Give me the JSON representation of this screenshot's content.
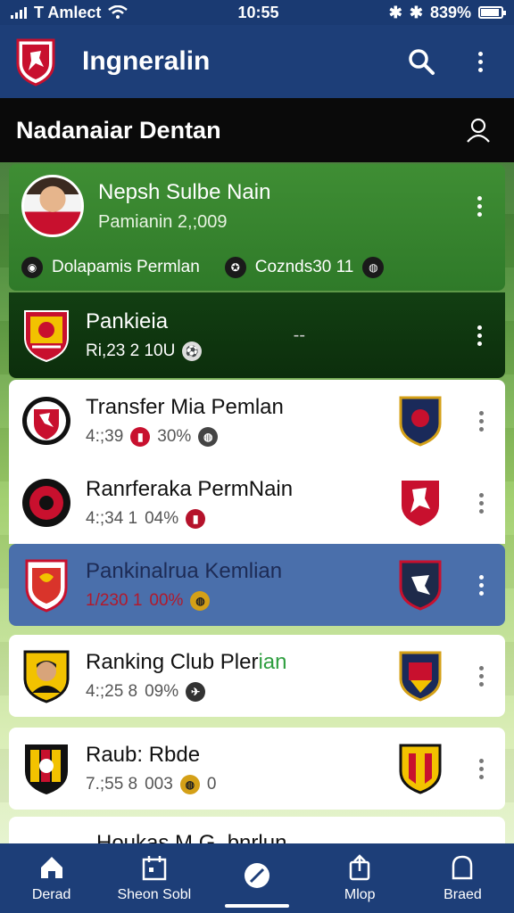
{
  "status_bar": {
    "carrier": "T Amlect",
    "time": "10:55",
    "battery": "839%"
  },
  "app_bar": {
    "title": "Ingneralin"
  },
  "section": {
    "title": "Nadanaiar Dentan"
  },
  "featured": {
    "name": "Nepsh Sulbe Nain",
    "subtitle": "Pamianin 2,;009",
    "left_stat": "Dolapamis Permlan",
    "right_stat": "Coznds30  11"
  },
  "dark_card": {
    "name": "Pankieia",
    "stat": "Ri,23  2 10U",
    "dash": "--"
  },
  "list": [
    {
      "name": "Transfer Mia Pemlan",
      "stat": "4:;39",
      "pct": "30%",
      "color": "#c8102e"
    },
    {
      "name": "Ranrferaka PermNain",
      "stat": "4:;34  1",
      "pct": "04%",
      "color": "#b5122b"
    },
    {
      "name": "Pankinalrua Kemlian",
      "stat": "1/230  1",
      "pct": "00%",
      "color": "#b5122b"
    },
    {
      "name": "Ranking Club Pler",
      "name_accent": "ian",
      "stat": "4:;25  8",
      "pct": "09%",
      "color": "#1e2a4a"
    },
    {
      "name": "Raub: Rbde",
      "stat": "7.;55  8",
      "pct": "003",
      "extra": "0",
      "color": "#c8102e"
    }
  ],
  "peek": {
    "name": "Houkas M.G..bnrlun"
  },
  "nav": [
    {
      "label": "Derad",
      "icon": "home-icon"
    },
    {
      "label": "Sheon Sobl",
      "icon": "calendar-icon"
    },
    {
      "label": "",
      "icon": "ball-icon"
    },
    {
      "label": "Mlop",
      "icon": "share-icon"
    },
    {
      "label": "Braed",
      "icon": "profile-icon"
    }
  ],
  "colors": {
    "app_bar": "#1d3e78",
    "selected": "#4a6fab",
    "accent_green": "#2e9e3f"
  }
}
